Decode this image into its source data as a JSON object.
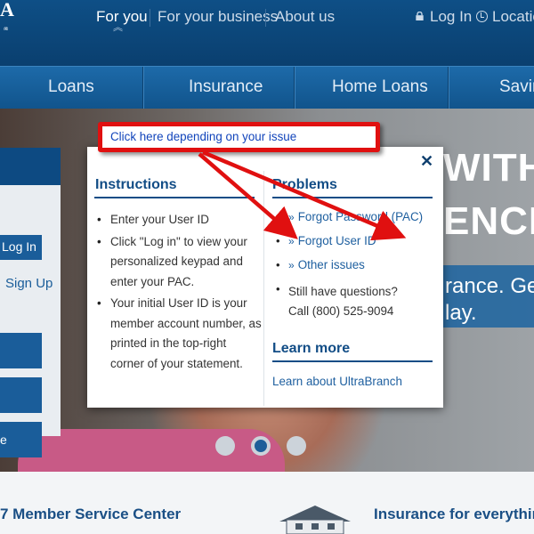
{
  "header": {
    "logo_letter": "A",
    "logo_reg": "®",
    "nav": [
      "For you",
      "For your business",
      "About us"
    ],
    "chevrons": "︽",
    "login_label": "Log In",
    "locations_label": "Locatio"
  },
  "main_nav": {
    "items": [
      "Loans",
      "Insurance",
      "Home Loans",
      "Savin"
    ]
  },
  "hero": {
    "headline_1": "WITH",
    "headline_2": "ENCE",
    "band_line_1": "rance. Get",
    "band_line_2": "lay.",
    "login_button": "Log In",
    "signup_link": "Sign Up",
    "tile_text": "e"
  },
  "footer": {
    "member_service": "7 Member Service Center",
    "insurance": "Insurance for everything"
  },
  "modal": {
    "close": "✕",
    "instructions": {
      "title": "Instructions",
      "items": [
        "Enter your User ID",
        "Click \"Log in\" to view your personalized keypad and enter your PAC.",
        "Your initial User ID is your member account number, as printed in the top-right corner of your statement."
      ]
    },
    "problems": {
      "title": "Problems",
      "links": [
        "Forgot Password (PAC)",
        "Forgot User ID",
        "Other issues"
      ],
      "still_line_1": "Still have questions?",
      "still_line_2": "Call (800) 525-9094"
    },
    "learn_more": {
      "title": "Learn more",
      "link": "Learn about UltraBranch"
    }
  },
  "annotation": {
    "text": "Click here depending on your issue"
  },
  "colors": {
    "brand_blue": "#0e4f86",
    "link_blue": "#1e5f9f",
    "annotation_red": "#e01010"
  }
}
